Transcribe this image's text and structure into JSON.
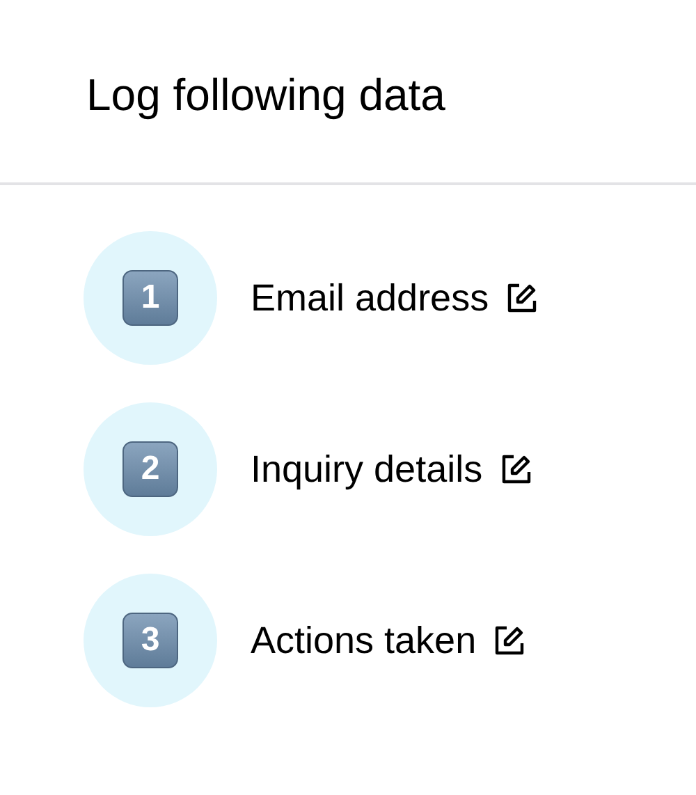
{
  "title": "Log following data",
  "steps": [
    {
      "number": "1",
      "label": "Email address"
    },
    {
      "number": "2",
      "label": "Inquiry details"
    },
    {
      "number": "3",
      "label": "Actions taken"
    }
  ]
}
